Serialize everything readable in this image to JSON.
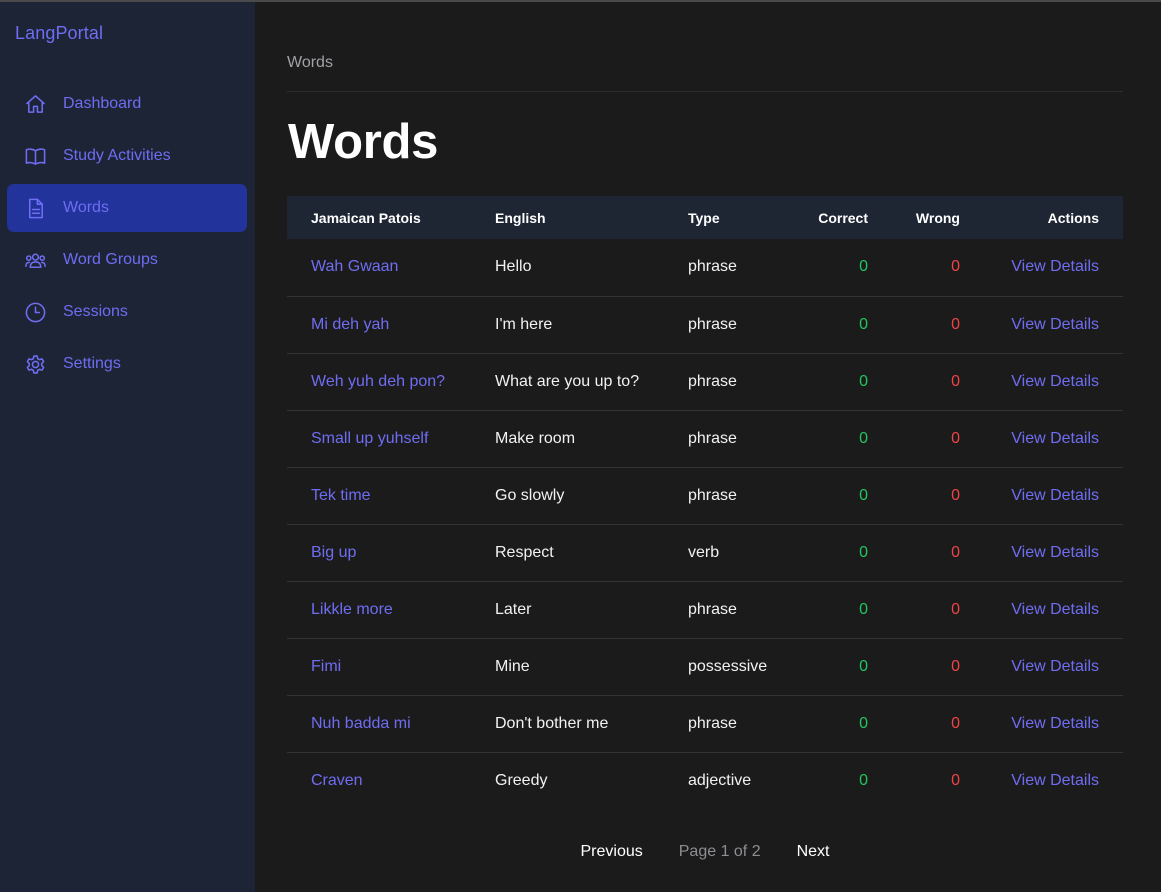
{
  "app": {
    "brand": "LangPortal"
  },
  "sidebar": {
    "items": [
      {
        "label": "Dashboard",
        "icon": "home-icon",
        "active": false
      },
      {
        "label": "Study Activities",
        "icon": "book-open-icon",
        "active": false
      },
      {
        "label": "Words",
        "icon": "document-icon",
        "active": true
      },
      {
        "label": "Word Groups",
        "icon": "users-group-icon",
        "active": false
      },
      {
        "label": "Sessions",
        "icon": "clock-icon",
        "active": false
      },
      {
        "label": "Settings",
        "icon": "gear-icon",
        "active": false
      }
    ]
  },
  "breadcrumb": "Words",
  "page_title": "Words",
  "table": {
    "headers": [
      "Jamaican Patois",
      "English",
      "Type",
      "Correct",
      "Wrong",
      "Actions"
    ],
    "rows": [
      {
        "patois": "Wah Gwaan",
        "english": "Hello",
        "type": "phrase",
        "correct": "0",
        "wrong": "0",
        "action": "View Details"
      },
      {
        "patois": "Mi deh yah",
        "english": "I'm here",
        "type": "phrase",
        "correct": "0",
        "wrong": "0",
        "action": "View Details"
      },
      {
        "patois": "Weh yuh deh pon?",
        "english": "What are you up to?",
        "type": "phrase",
        "correct": "0",
        "wrong": "0",
        "action": "View Details"
      },
      {
        "patois": "Small up yuhself",
        "english": "Make room",
        "type": "phrase",
        "correct": "0",
        "wrong": "0",
        "action": "View Details"
      },
      {
        "patois": "Tek time",
        "english": "Go slowly",
        "type": "phrase",
        "correct": "0",
        "wrong": "0",
        "action": "View Details"
      },
      {
        "patois": "Big up",
        "english": "Respect",
        "type": "verb",
        "correct": "0",
        "wrong": "0",
        "action": "View Details"
      },
      {
        "patois": "Likkle more",
        "english": "Later",
        "type": "phrase",
        "correct": "0",
        "wrong": "0",
        "action": "View Details"
      },
      {
        "patois": "Fimi",
        "english": "Mine",
        "type": "possessive",
        "correct": "0",
        "wrong": "0",
        "action": "View Details"
      },
      {
        "patois": "Nuh badda mi",
        "english": "Don't bother me",
        "type": "phrase",
        "correct": "0",
        "wrong": "0",
        "action": "View Details"
      },
      {
        "patois": "Craven",
        "english": "Greedy",
        "type": "adjective",
        "correct": "0",
        "wrong": "0",
        "action": "View Details"
      }
    ]
  },
  "pagination": {
    "previous": "Previous",
    "info": "Page 1 of 2",
    "next": "Next"
  },
  "colors": {
    "accent": "#6f6df2",
    "sidebar_bg": "#1c2436",
    "active_item_bg": "#22339b",
    "correct": "#22c55e",
    "wrong": "#ef4444"
  }
}
